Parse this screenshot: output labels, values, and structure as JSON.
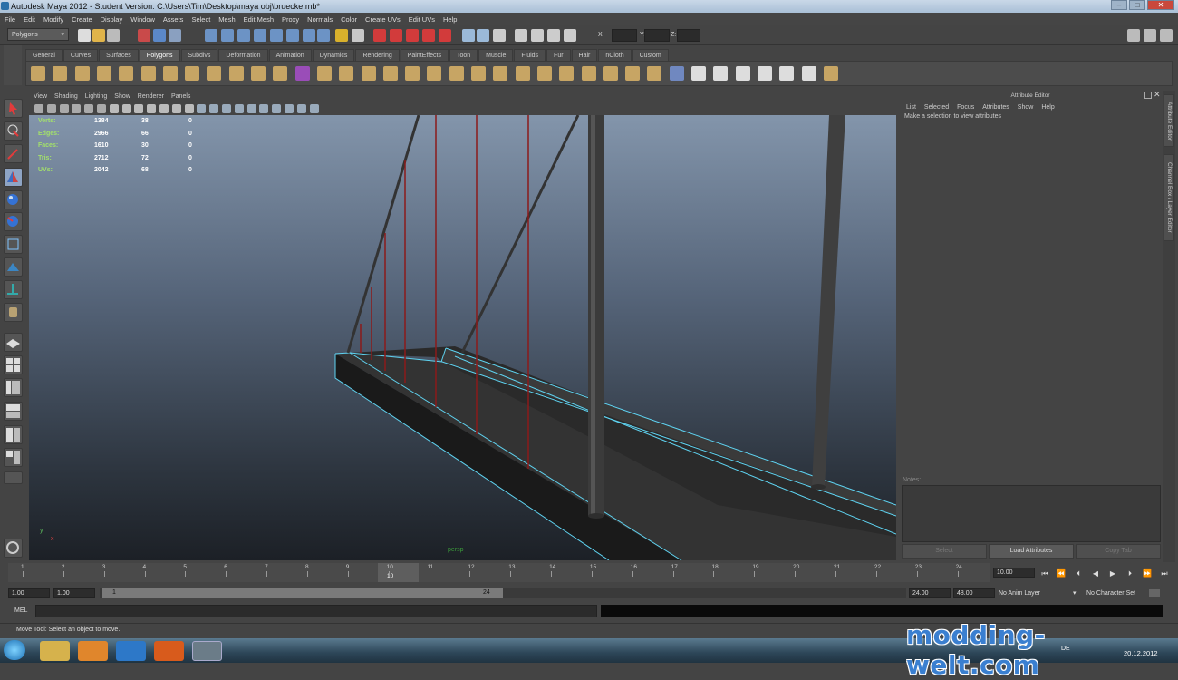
{
  "window": {
    "title": "Autodesk Maya 2012 - Student Version: C:\\Users\\Tim\\Desktop\\maya obj\\bruecke.mb*"
  },
  "menu": [
    "File",
    "Edit",
    "Modify",
    "Create",
    "Display",
    "Window",
    "Assets",
    "Select",
    "Mesh",
    "Edit Mesh",
    "Proxy",
    "Normals",
    "Color",
    "Create UVs",
    "Edit UVs",
    "Help"
  ],
  "status": {
    "mode": "Polygons",
    "x_label": "X:",
    "y_label": "Y:",
    "z_label": "Z:"
  },
  "shelf_tabs": [
    {
      "label": "General",
      "active": false
    },
    {
      "label": "Curves",
      "active": false
    },
    {
      "label": "Surfaces",
      "active": false
    },
    {
      "label": "Polygons",
      "active": true
    },
    {
      "label": "Subdivs",
      "active": false
    },
    {
      "label": "Deformation",
      "active": false
    },
    {
      "label": "Animation",
      "active": false
    },
    {
      "label": "Dynamics",
      "active": false
    },
    {
      "label": "Rendering",
      "active": false
    },
    {
      "label": "PaintEffects",
      "active": false
    },
    {
      "label": "Toon",
      "active": false
    },
    {
      "label": "Muscle",
      "active": false
    },
    {
      "label": "Fluids",
      "active": false
    },
    {
      "label": "Fur",
      "active": false
    },
    {
      "label": "Hair",
      "active": false
    },
    {
      "label": "nCloth",
      "active": false
    },
    {
      "label": "Custom",
      "active": false
    }
  ],
  "viewport": {
    "menu": [
      "View",
      "Shading",
      "Lighting",
      "Show",
      "Renderer",
      "Panels"
    ],
    "hud": [
      {
        "label": "Verts:",
        "a": "1384",
        "b": "38",
        "c": "0"
      },
      {
        "label": "Edges:",
        "a": "2966",
        "b": "66",
        "c": "0"
      },
      {
        "label": "Faces:",
        "a": "1610",
        "b": "30",
        "c": "0"
      },
      {
        "label": "Tris:",
        "a": "2712",
        "b": "72",
        "c": "0"
      },
      {
        "label": "UVs:",
        "a": "2042",
        "b": "68",
        "c": "0"
      }
    ],
    "camera": "persp",
    "axis_y": "y",
    "axis_x": "x"
  },
  "attribute_editor": {
    "title": "Attribute Editor",
    "menu": [
      "List",
      "Selected",
      "Focus",
      "Attributes",
      "Show",
      "Help"
    ],
    "message": "Make a selection to view attributes",
    "notes_label": "Notes:",
    "buttons": [
      "Select",
      "Load Attributes",
      "Copy Tab"
    ]
  },
  "side_tabs": [
    "Attribute Editor",
    "Channel Box / Layer Editor"
  ],
  "timeline": {
    "ticks": [
      "1",
      "2",
      "3",
      "4",
      "5",
      "6",
      "7",
      "8",
      "9",
      "10",
      "11",
      "12",
      "13",
      "14",
      "15",
      "16",
      "17",
      "18",
      "19",
      "20",
      "21",
      "22",
      "23",
      "24"
    ],
    "current_frame": "10",
    "current_field": "10.00"
  },
  "range": {
    "start": "1.00",
    "start2": "1.00",
    "slider_start": "1",
    "slider_end": "24",
    "end": "24.00",
    "end2": "48.00",
    "anim_layer": "No Anim Layer",
    "char_set": "No Character Set"
  },
  "command": {
    "label": "MEL"
  },
  "help_line": "Move Tool: Select an object to move.",
  "watermark": "modding-welt.com",
  "clock": {
    "date": "20.12.2012",
    "lang": "DE"
  },
  "colors": {
    "hud_label": "#a3e06b",
    "wire_highlight": "#5fd4f2",
    "cable_red": "#8b1a1a"
  }
}
